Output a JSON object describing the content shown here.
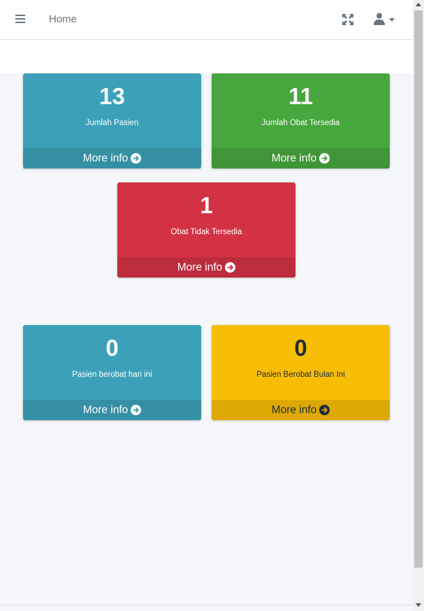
{
  "navbar": {
    "home_label": "Home",
    "icons": [
      "menu-icon",
      "expand-icon",
      "user-icon",
      "caret-down-icon"
    ]
  },
  "boxes": [
    {
      "count": "13",
      "label": "Jumlah Pasien",
      "footer": "More info",
      "color": "#3ca1b8"
    },
    {
      "count": "11",
      "label": "Jumlah Obat Tersedia",
      "footer": "More info",
      "color": "#47a63e"
    },
    {
      "count": "1",
      "label": "Obat Tidak Tersedia",
      "footer": "More info",
      "color": "#d23243"
    },
    {
      "count": "0",
      "label": "Pasien berobat hari ini",
      "footer": "More info",
      "color": "#3ca1b8"
    },
    {
      "count": "0",
      "label": "Pasien Berobat Bulan Ini",
      "footer": "More info",
      "color": "#f8bd05"
    }
  ]
}
